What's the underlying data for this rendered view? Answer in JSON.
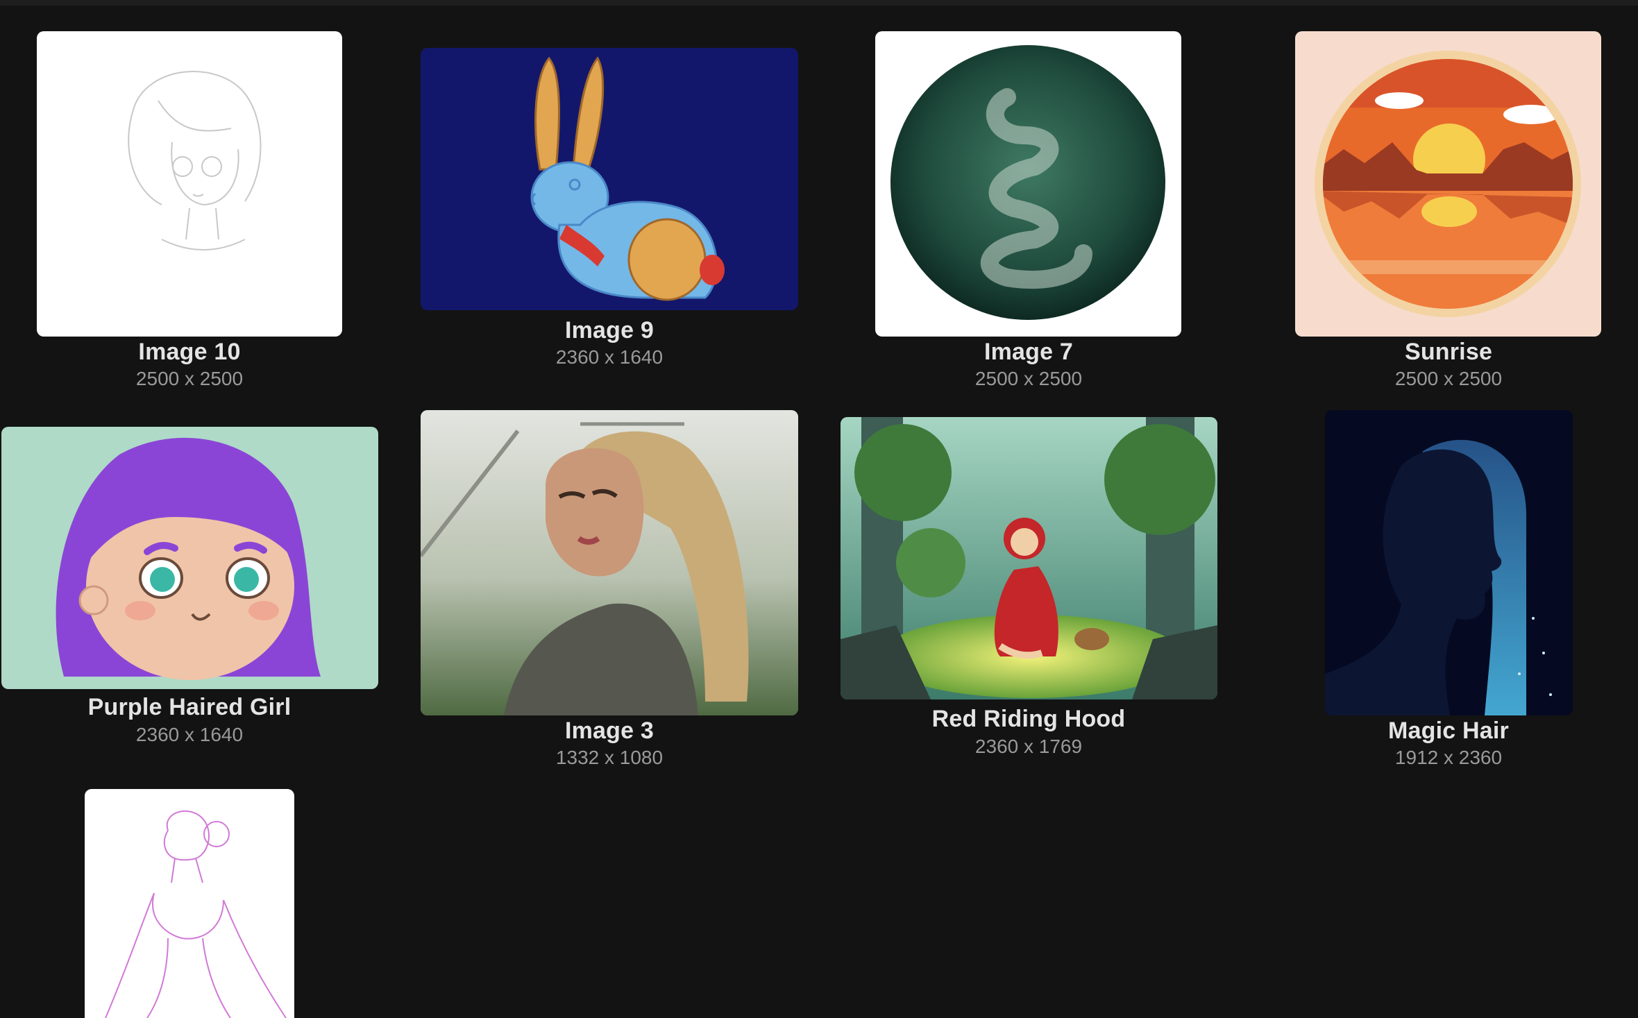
{
  "gallery": {
    "items": [
      {
        "title": "Image 10",
        "dimensions": "2500 x 2500",
        "thumbnail": "sketch-girl-portrait"
      },
      {
        "title": "Image 9",
        "dimensions": "2360 x 1640",
        "thumbnail": "blue-rabbit"
      },
      {
        "title": "Image 7",
        "dimensions": "2500 x 2500",
        "thumbnail": "green-circle-snake"
      },
      {
        "title": "Sunrise",
        "dimensions": "2500 x 2500",
        "thumbnail": "sunrise-badge"
      },
      {
        "title": "Purple Haired Girl",
        "dimensions": "2360 x 1640",
        "thumbnail": "purple-haired-girl"
      },
      {
        "title": "Image 3",
        "dimensions": "1332 x 1080",
        "thumbnail": "blonde-woman-photo"
      },
      {
        "title": "Red Riding Hood",
        "dimensions": "2360 x 1769",
        "thumbnail": "red-riding-hood-forest"
      },
      {
        "title": "Magic Hair",
        "dimensions": "1912 x 2360",
        "thumbnail": "magic-hair-silhouette"
      },
      {
        "title": "",
        "dimensions": "",
        "thumbnail": "pink-sketch-woman"
      }
    ]
  },
  "colors": {
    "background": "#131313",
    "title_text": "#e4e4e4",
    "dims_text": "#9a9a9a"
  }
}
